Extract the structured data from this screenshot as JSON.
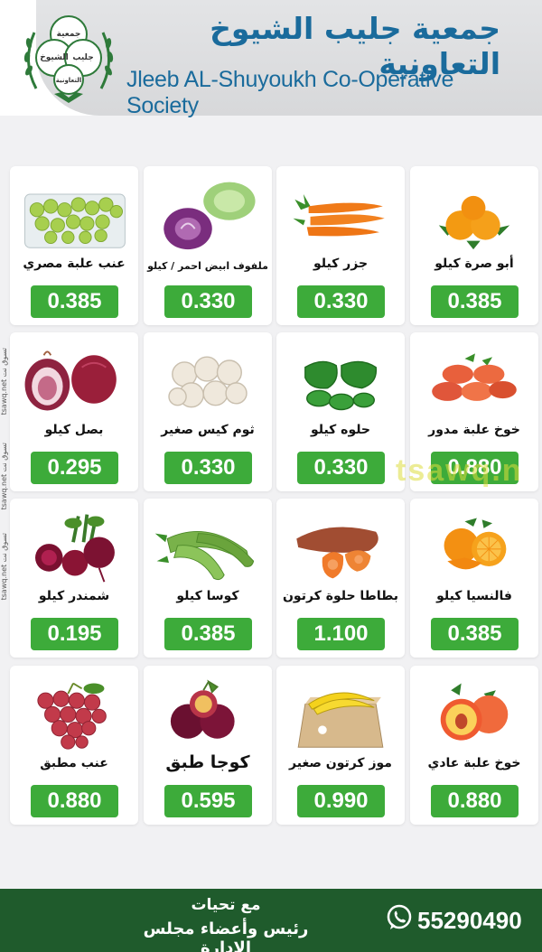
{
  "header": {
    "title_ar": "جمعية جليب الشيوخ التعاونية",
    "title_en": "Jleeb AL-Shuyoukh Co-Operative Society",
    "logo_lines": [
      "جمعية",
      "جليب",
      "الشيوخ",
      "التعاونية"
    ]
  },
  "watermark": {
    "text": "tsawq.n",
    "side_text": "tsawq.net تسوق نت"
  },
  "products": [
    {
      "name": "أبو صرة كيلو",
      "price": "0.385",
      "icon": "mandarin-icon"
    },
    {
      "name": "جزر كيلو",
      "price": "0.330",
      "icon": "carrot-icon"
    },
    {
      "name": "ملفوف ابيض احمر / كيلو",
      "price": "0.330",
      "icon": "cabbage-icon"
    },
    {
      "name": "عنب علبة مصري",
      "price": "0.385",
      "icon": "green-grapes-icon"
    },
    {
      "name": "خوخ علبة مدور",
      "price": "0.880",
      "icon": "flat-peach-icon"
    },
    {
      "name": "حلوه كيلو",
      "price": "0.330",
      "icon": "green-pepper-icon"
    },
    {
      "name": "ثوم كيس صغير",
      "price": "0.330",
      "icon": "garlic-icon"
    },
    {
      "name": "بصل كيلو",
      "price": "0.295",
      "icon": "red-onion-icon"
    },
    {
      "name": "فالنسيا كيلو",
      "price": "0.385",
      "icon": "orange-icon"
    },
    {
      "name": "بطاطا حلوة كرتون",
      "price": "1.100",
      "icon": "sweet-potato-icon"
    },
    {
      "name": "كوسا كيلو",
      "price": "0.385",
      "icon": "zucchini-icon"
    },
    {
      "name": "شمندر كيلو",
      "price": "0.195",
      "icon": "beetroot-icon"
    },
    {
      "name": "خوخ علبة عادي",
      "price": "0.880",
      "icon": "peach-icon"
    },
    {
      "name": "موز كرتون صغير",
      "price": "0.990",
      "icon": "banana-box-icon"
    },
    {
      "name": "كوجا طبق",
      "price": "0.595",
      "icon": "plum-icon"
    },
    {
      "name": "عنب مطبق",
      "price": "0.880",
      "icon": "red-grapes-icon"
    }
  ],
  "footer": {
    "greeting_line1": "مع تحيات",
    "greeting_line2": "رئيس وأعضاء مجلس الإدارة",
    "phone": "55290490",
    "phone_icon": "whatsapp-icon"
  },
  "colors": {
    "brand_blue": "#1a6b9c",
    "price_green": "#3dab3a",
    "footer_green": "#1f5b2c"
  }
}
